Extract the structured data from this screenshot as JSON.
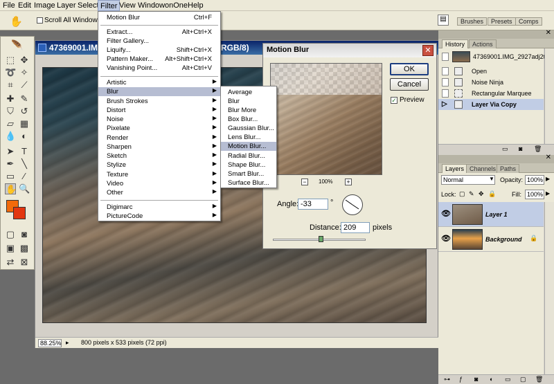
{
  "menubar": {
    "items": [
      "File",
      "Edit",
      "Image",
      "Layer",
      "Select",
      "Filter",
      "View",
      "Window",
      "onOne",
      "Help"
    ]
  },
  "optbar": {
    "scroll_all_windows": "Scroll All Windows",
    "palette_tabs": [
      "Brushes",
      "Presets",
      "Comps"
    ]
  },
  "filter_menu": {
    "last_filter": "Motion Blur",
    "last_filter_shortcut": "Ctrl+F",
    "extract": "Extract...",
    "extract_shortcut": "Alt+Ctrl+X",
    "filter_gallery": "Filter Gallery...",
    "liquify": "Liquify...",
    "liquify_shortcut": "Shift+Ctrl+X",
    "pattern_maker": "Pattern Maker...",
    "pattern_maker_shortcut": "Alt+Shift+Ctrl+X",
    "vanishing_point": "Vanishing Point...",
    "vanishing_point_shortcut": "Alt+Ctrl+V",
    "submenus": [
      "Artistic",
      "Blur",
      "Brush Strokes",
      "Distort",
      "Noise",
      "Pixelate",
      "Render",
      "Sharpen",
      "Sketch",
      "Stylize",
      "Texture",
      "Video",
      "Other"
    ],
    "plugins": [
      "Digimarc",
      "PictureCode"
    ]
  },
  "blur_menu": {
    "items": [
      "Average",
      "Blur",
      "Blur More",
      "Box Blur...",
      "Gaussian Blur...",
      "Lens Blur...",
      "Motion Blur...",
      "Radial Blur...",
      "Shape Blur...",
      "Smart Blur...",
      "Surface Blur..."
    ]
  },
  "document": {
    "title": "47369001.IMG",
    "title_suffix": "RGB/8)",
    "zoom": "88.25%",
    "info": "800 pixels x 533 pixels (72 ppi)"
  },
  "dialog": {
    "title": "Motion Blur",
    "ok": "OK",
    "cancel": "Cancel",
    "preview_label": "Preview",
    "preview_zoom": "100%",
    "angle_label": "Angle:",
    "angle_value": "-33",
    "angle_unit": "°",
    "distance_label": "Distance:",
    "distance_value": "209",
    "distance_unit": "pixels"
  },
  "history": {
    "tabs": [
      "History",
      "Actions"
    ],
    "snapshot": "47369001.IMG_2927adj2ts",
    "steps": [
      "Open",
      "Noise Ninja",
      "Rectangular Marquee",
      "Layer Via Copy"
    ]
  },
  "layers": {
    "tabs": [
      "Layers",
      "Channels",
      "Paths"
    ],
    "blend_mode": "Normal",
    "opacity_label": "Opacity:",
    "opacity": "100%",
    "lock_label": "Lock:",
    "fill_label": "Fill:",
    "fill": "100%",
    "items": [
      "Layer 1",
      "Background"
    ]
  }
}
